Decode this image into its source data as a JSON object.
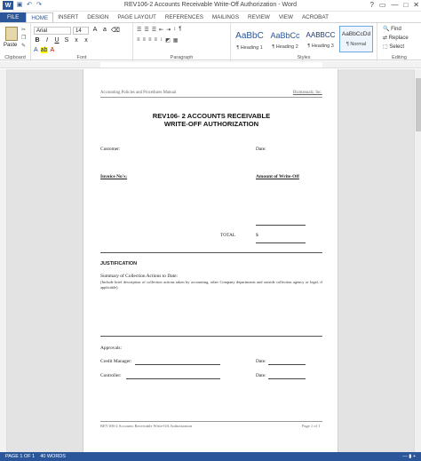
{
  "window": {
    "app_letter": "W",
    "title": "REV106-2 Accounts Receivable Write-Off Authorization - Word",
    "controls": [
      "?",
      "▭",
      "—",
      "□",
      "✕"
    ]
  },
  "tabs": [
    "FILE",
    "HOME",
    "INSERT",
    "DESIGN",
    "PAGE LAYOUT",
    "REFERENCES",
    "MAILINGS",
    "REVIEW",
    "VIEW",
    "ACROBAT"
  ],
  "ribbon": {
    "clipboard": {
      "paste": "Paste",
      "label": "Clipboard"
    },
    "font": {
      "family": "Arial",
      "size": "14",
      "label": "Font"
    },
    "paragraph": {
      "label": "Paragraph"
    },
    "styles": {
      "label": "Styles",
      "items": [
        {
          "sample": "AaBbC",
          "name": "¶ Heading 1"
        },
        {
          "sample": "AaBbCc",
          "name": "¶ Heading 2"
        },
        {
          "sample": "AABBCC",
          "name": "¶ Heading 3"
        },
        {
          "sample": "AaBbCcDd",
          "name": "¶ Normal"
        }
      ]
    },
    "editing": {
      "find": "Find",
      "replace": "Replace",
      "select": "Select",
      "label": "Editing"
    }
  },
  "document": {
    "header_left": "Accounting Policies and Procedures Manual",
    "header_right": "Bizmanualz, Inc.",
    "title_line1": "REV106- 2 ACCOUNTS RECEIVABLE",
    "title_line2": "WRITE-OFF AUTHORIZATION",
    "customer": "Customer:",
    "date": "Date:",
    "invoice_nos": "Invoice No's:",
    "amount": "Amount of Write-Off",
    "total": "TOTAL",
    "dollar": "$",
    "justification": "JUSTIFICATION",
    "summary": "Summary of Collection Actions to Date:",
    "summary_note": "(Include brief description of collection actions taken by accounting, other Company departments and outside collection agency or legal, if applicable)",
    "approvals": "Approvals:",
    "credit_manager": "Credit Manager:",
    "controller": "Controller:",
    "date2": "Date:",
    "date3": "Date:",
    "footer_left": "REV106-2 Accounts Receivable Write-Off Authorization",
    "footer_right": "Page 1 of 1"
  },
  "status": {
    "page": "PAGE 1 OF 1",
    "words": "40 WORDS"
  }
}
